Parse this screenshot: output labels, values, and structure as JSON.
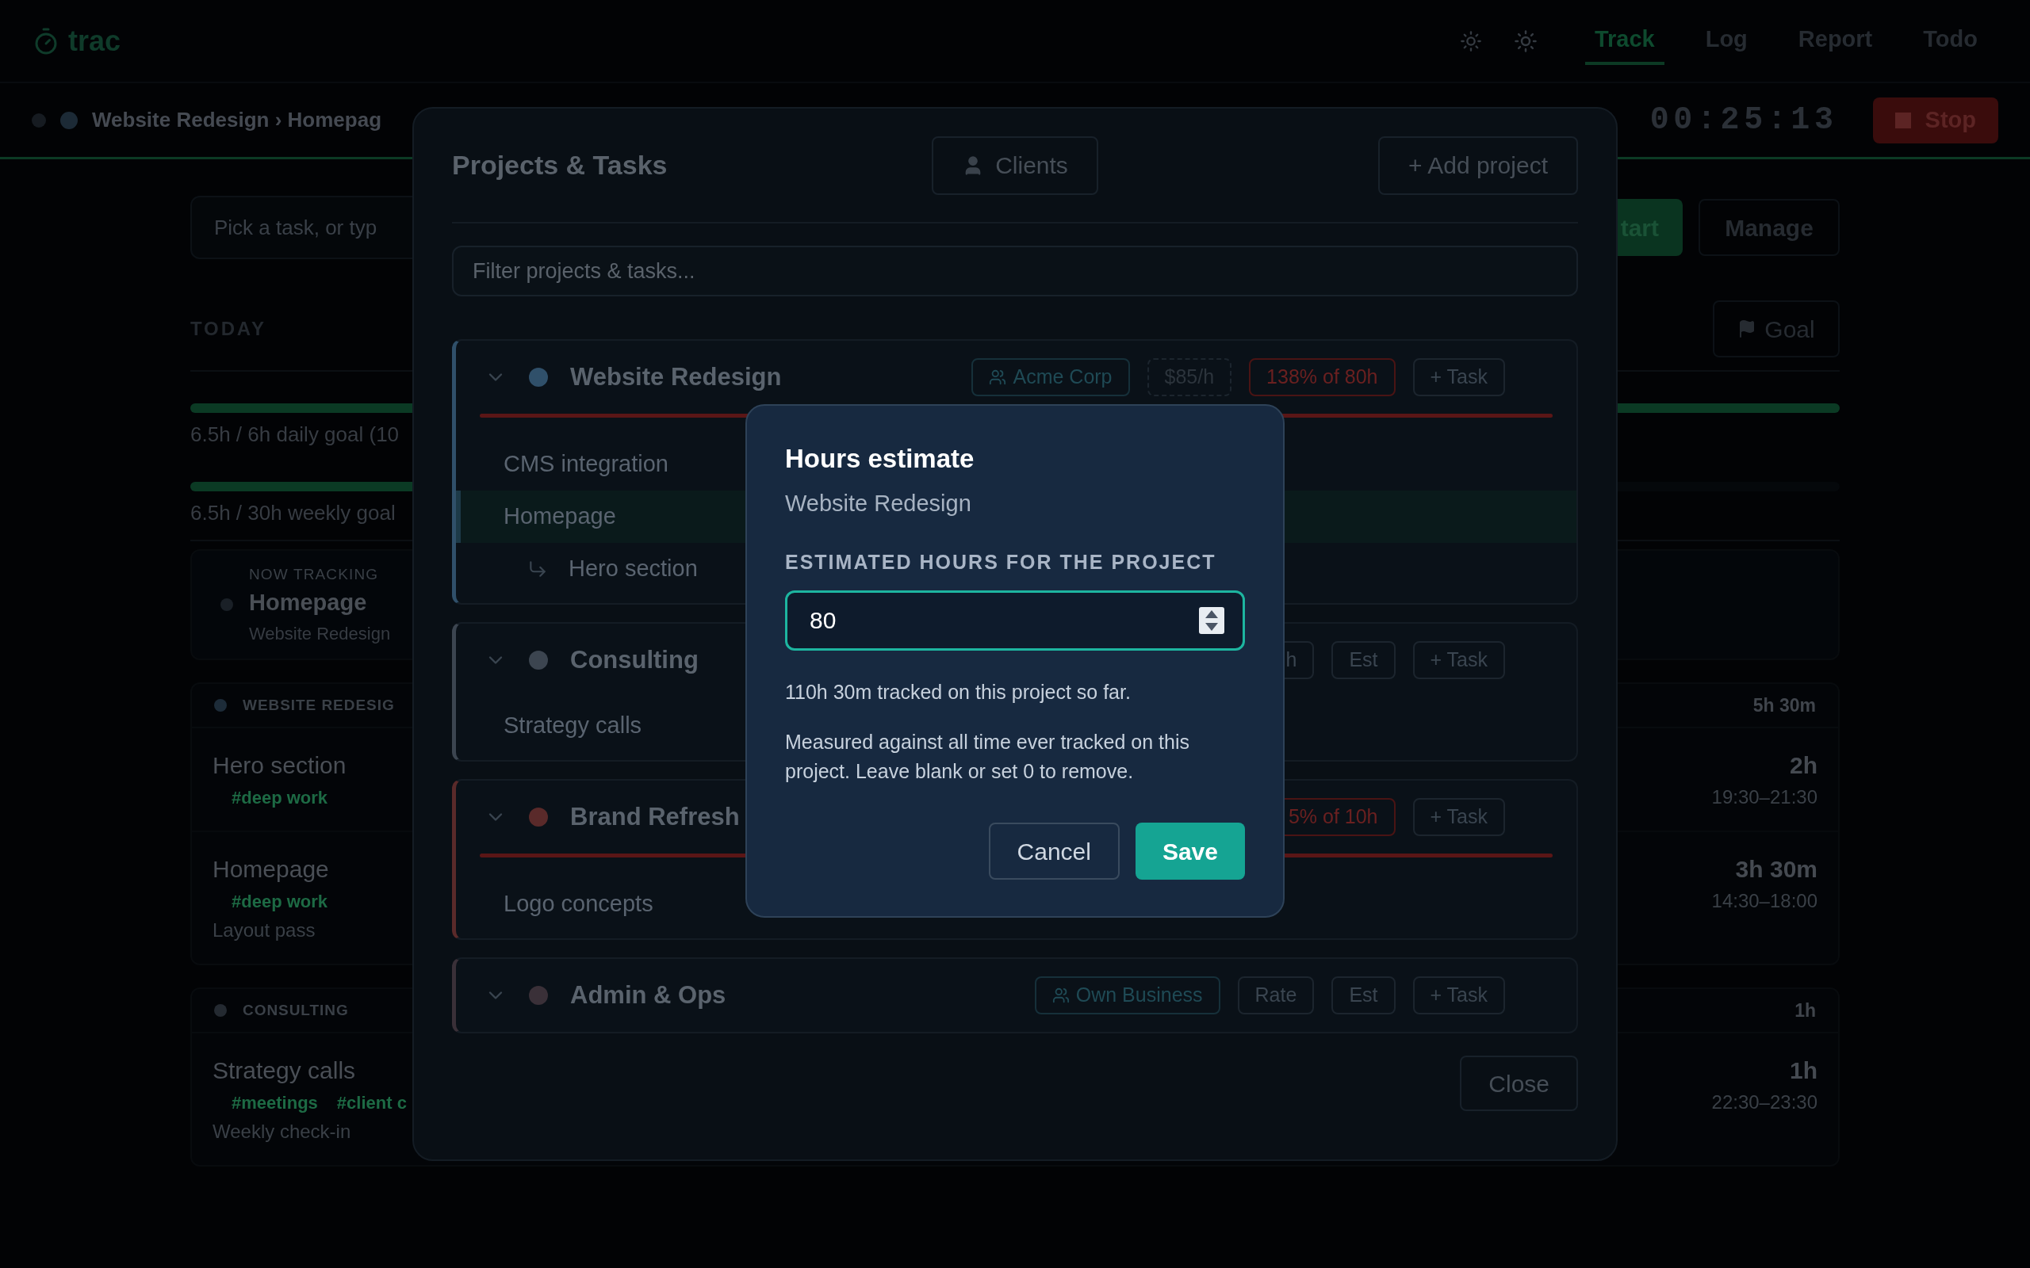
{
  "header": {
    "logo": "trac",
    "nav": [
      {
        "label": "Track",
        "selected": true
      },
      {
        "label": "Log",
        "selected": false
      },
      {
        "label": "Report",
        "selected": false
      },
      {
        "label": "Todo",
        "selected": false
      }
    ]
  },
  "tracking_bar": {
    "breadcrumb": "Website Redesign › Homepag",
    "timer": "00:25:13",
    "stop_button": "Stop"
  },
  "task_entry": {
    "placeholder": "Pick a task, or typ",
    "start_button": "tart",
    "manage_button": "Manage"
  },
  "today": {
    "heading": "TODAY",
    "goal_button": "Goal",
    "goals": [
      {
        "label": "6.5h / 6h daily goal (10",
        "level": 1
      },
      {
        "label": "6.5h / 30h weekly goal",
        "level": 0.22
      }
    ]
  },
  "now_tracking": {
    "label": "NOW TRACKING",
    "task": "Homepage",
    "project": "Website Redesign"
  },
  "groups": [
    {
      "name": "WEBSITE REDESIG",
      "color": "#1d2c39",
      "total": "5h 30m",
      "entries": [
        {
          "title": "Hero section",
          "tags": [
            "#deep work"
          ],
          "duration": "2h",
          "range": "19:30–21:30"
        },
        {
          "title": "Homepage",
          "tags": [
            "#deep work"
          ],
          "note": "Layout pass",
          "duration": "3h 30m",
          "range": "14:30–18:00"
        }
      ]
    },
    {
      "name": "CONSULTING",
      "color": "#242a31",
      "total": "1h",
      "entries": [
        {
          "title": "Strategy calls",
          "tags": [
            "#meetings",
            "#client c"
          ],
          "note": "Weekly check-in",
          "duration": "1h",
          "range": "22:30–23:30"
        }
      ]
    }
  ],
  "projects_modal": {
    "title": "Projects & Tasks",
    "clients_button": "Clients",
    "add_button": "+ Add project",
    "filter": {
      "placeholder": "Filter projects & tasks..."
    },
    "projects": [
      {
        "name": "Website Redesign",
        "color": "#30506a",
        "over_budget": true,
        "expanded": true,
        "badges": [
          {
            "kind": "client",
            "text": "Acme Corp"
          },
          {
            "kind": "rate",
            "text": "$85/h"
          },
          {
            "kind": "budget",
            "text": "138% of 80h"
          },
          {
            "kind": "add",
            "text": "+ Task"
          }
        ],
        "tasks": [
          {
            "name": "CMS integration",
            "selected": false
          },
          {
            "name": "Homepage",
            "selected": true,
            "children": [
              {
                "name": "Hero section",
                "selected": false
              }
            ]
          }
        ]
      },
      {
        "name": "Consulting",
        "color": "#3c4550",
        "over_budget": false,
        "expanded": true,
        "badges": [
          {
            "kind": "plain",
            "text": "h"
          },
          {
            "kind": "plain",
            "text": "Est"
          },
          {
            "kind": "add",
            "text": "+ Task"
          }
        ],
        "tasks": [
          {
            "name": "Strategy calls",
            "selected": false
          }
        ]
      },
      {
        "name": "Brand Refresh",
        "color": "#5a2a2a",
        "over_budget": true,
        "expanded": true,
        "badges": [
          {
            "kind": "budget",
            "text": "5% of 10h"
          },
          {
            "kind": "add",
            "text": "+ Task"
          }
        ],
        "tasks": [
          {
            "name": "Logo concepts",
            "selected": false
          }
        ]
      },
      {
        "name": "Admin & Ops",
        "color": "#3a3038",
        "over_budget": false,
        "expanded": true,
        "badges": [
          {
            "kind": "client",
            "text": "Own Business"
          },
          {
            "kind": "plain",
            "text": "Rate"
          },
          {
            "kind": "plain",
            "text": "Est"
          },
          {
            "kind": "add",
            "text": "+ Task"
          }
        ]
      }
    ],
    "close_button": "Close"
  },
  "dialog": {
    "title": "Hours estimate",
    "subtitle": "Website Redesign",
    "field_label": "ESTIMATED HOURS FOR THE PROJECT",
    "value": "80",
    "tracked_note": "110h 30m tracked on this project so far.",
    "help": "Measured against all time ever tracked on this project. Leave blank or set 0 to remove.",
    "cancel_button": "Cancel",
    "save_button": "Save"
  }
}
